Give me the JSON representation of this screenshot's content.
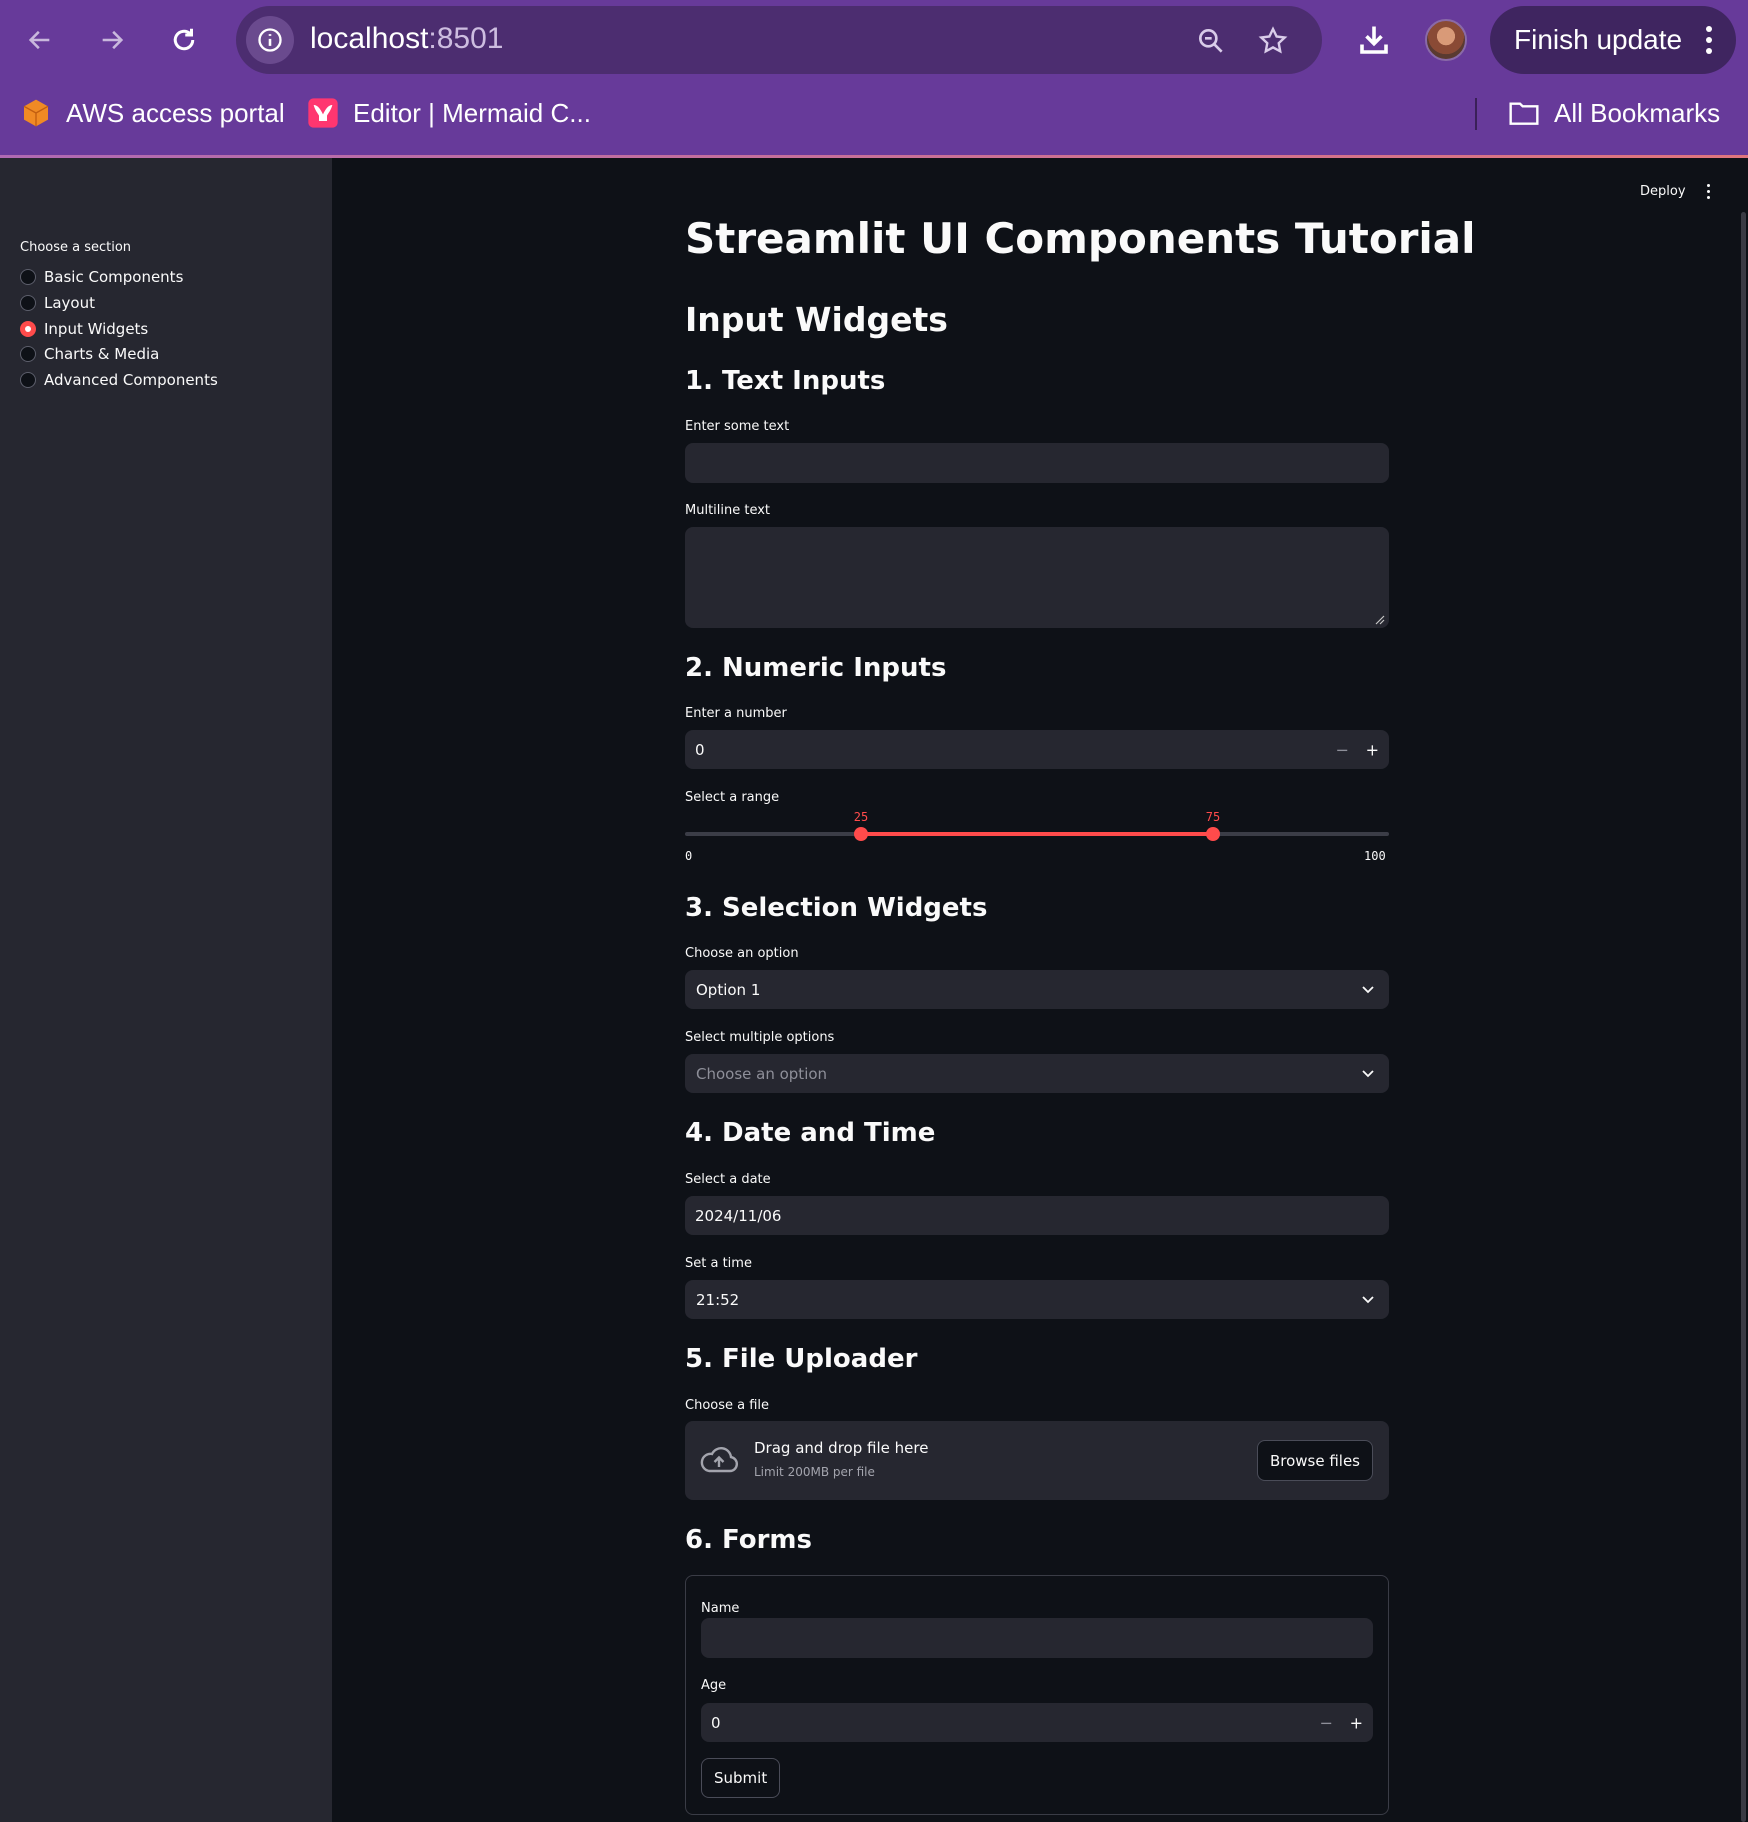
{
  "browser": {
    "url_host": "localhost",
    "url_port": ":8501",
    "finish_update": "Finish update",
    "bookmarks": [
      "AWS access portal",
      "Editor | Mermaid C..."
    ],
    "all_bookmarks": "All Bookmarks"
  },
  "sidebar": {
    "title": "Choose a section",
    "options": [
      "Basic Components",
      "Layout",
      "Input Widgets",
      "Charts & Media",
      "Advanced Components"
    ],
    "selected": "Input Widgets"
  },
  "toolbar": {
    "deploy": "Deploy"
  },
  "main": {
    "title": "Streamlit UI Components Tutorial",
    "section": "Input Widgets",
    "text_inputs": {
      "heading": "1. Text Inputs",
      "text_label": "Enter some text",
      "text_value": "",
      "multiline_label": "Multiline text",
      "multiline_value": ""
    },
    "numeric_inputs": {
      "heading": "2. Numeric Inputs",
      "number_label": "Enter a number",
      "number_value": "0",
      "minus": "−",
      "plus": "+",
      "range_label": "Select a range",
      "range_low": "25",
      "range_high": "75",
      "range_min": "0",
      "range_max": "100"
    },
    "selection": {
      "heading": "3. Selection Widgets",
      "select_label": "Choose an option",
      "select_value": "Option 1",
      "multi_label": "Select multiple options",
      "multi_placeholder": "Choose an option"
    },
    "datetime": {
      "heading": "4. Date and Time",
      "date_label": "Select a date",
      "date_value": "2024/11/06",
      "time_label": "Set a time",
      "time_value": "21:52"
    },
    "upload": {
      "heading": "5. File Uploader",
      "label": "Choose a file",
      "drag_text": "Drag and drop file here",
      "limit_text": "Limit 200MB per file",
      "browse": "Browse files"
    },
    "forms": {
      "heading": "6. Forms",
      "name_label": "Name",
      "name_value": "",
      "age_label": "Age",
      "age_value": "0",
      "submit": "Submit"
    }
  },
  "colors": {
    "accent": "#ff4b4b",
    "background": "#0e1117",
    "sidebar": "#262730",
    "browser_chrome": "#673a9a"
  },
  "range_slider": {
    "min": 0,
    "max": 100,
    "low": 25,
    "high": 75
  }
}
